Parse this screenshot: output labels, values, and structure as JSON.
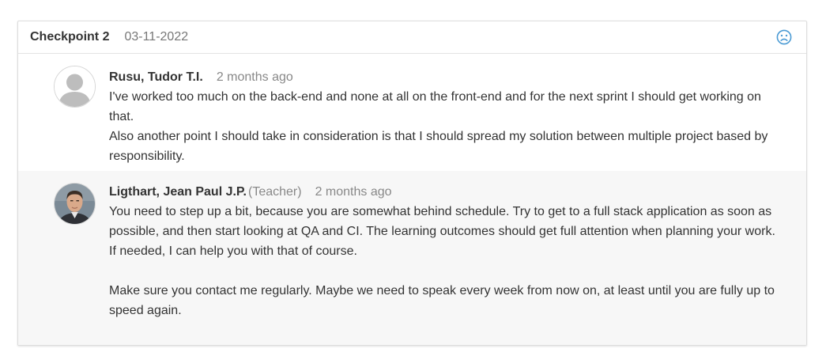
{
  "checkpoint": {
    "title": "Checkpoint 2",
    "date": "03-11-2022",
    "mood_icon": "sad-face-icon",
    "mood_color": "#4a9ad4"
  },
  "comments": [
    {
      "author": "Rusu, Tudor T.I.",
      "time": "2 months ago",
      "avatar": "default-user-avatar",
      "paragraphs": [
        "I've worked too much on the back-end and none at all on the front-end and for the next sprint I should get working on that.",
        "Also another point I should take in consideration is that I should spread my solution between multiple project based by responsibility."
      ]
    },
    {
      "author": "Ligthart, Jean Paul J.P.",
      "role": "(Teacher)",
      "time": "2 months ago",
      "avatar": "teacher-photo-avatar",
      "paragraphs": [
        "You need to step up a bit, because you are somewhat behind schedule. Try to get to a full stack application as soon as possible, and then start looking at QA and CI. The learning outcomes should get full attention when planning your work.",
        "If needed, I can help you with that of course.",
        "",
        "Make sure you contact me regularly. Maybe we need to speak every week from now on, at least until you are fully up to speed again."
      ]
    }
  ]
}
